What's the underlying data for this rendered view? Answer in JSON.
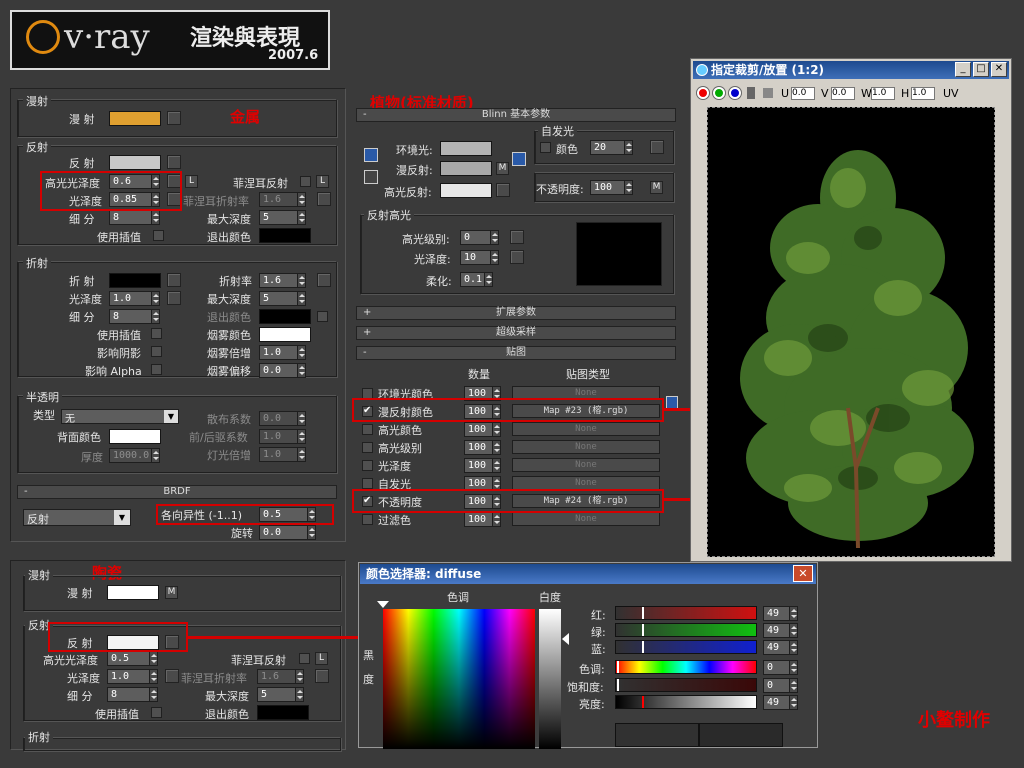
{
  "logo": {
    "brand": "v·ray",
    "title": "渲染與表現",
    "year": "2007.6"
  },
  "metal": {
    "heading": "金属",
    "diffuse_group": "漫射",
    "diffuse_label": "漫 射",
    "diffuse_color": "#e0a030",
    "reflect_group": "反射",
    "reflect_label": "反 射",
    "reflect_color": "#c8c8c8",
    "hilight_gloss_label": "高光光泽度",
    "hilight_gloss": "0.6",
    "gloss_label": "光泽度",
    "gloss": "0.85",
    "subdiv_label": "细 分",
    "subdiv": "8",
    "interp_label": "使用插值",
    "fresnel_label": "菲涅耳反射",
    "fresnel_ior_label": "菲涅耳折射率",
    "fresnel_ior": "1.6",
    "maxdepth_label": "最大深度",
    "maxdepth": "5",
    "exit_color_label": "退出颜色",
    "L": "L",
    "refract_group": "折射",
    "refract_label": "折 射",
    "ior_label": "折射率",
    "ior": "1.6",
    "r_gloss_label": "光泽度",
    "r_gloss": "1.0",
    "r_maxdepth_label": "最大深度",
    "r_maxdepth": "5",
    "r_subdiv_label": "细 分",
    "r_subdiv": "8",
    "r_exit_label": "退出颜色",
    "r_interp_label": "使用插值",
    "fog_color_label": "烟雾颜色",
    "shadow_label": "影响阴影",
    "fog_mult_label": "烟雾倍增",
    "fog_mult": "1.0",
    "alpha_label": "影响 Alpha",
    "fog_bias_label": "烟雾偏移",
    "fog_bias": "0.0",
    "trans_group": "半透明",
    "type_label": "类型",
    "type_value": "无",
    "scatter_label": "散布系数",
    "scatter": "0.0",
    "back_color_label": "背面颜色",
    "fb_label": "前/后驱系数",
    "fb": "1.0",
    "thick_label": "厚度",
    "thick": "1000.0",
    "light_mult_label": "灯光倍增",
    "light_mult": "1.0",
    "brdf_title": "BRDF",
    "brdf_type": "反射",
    "aniso_label": "各向异性 (-1..1)",
    "aniso": "0.5",
    "rotate_label": "旋转",
    "rotate": "0.0"
  },
  "blinn": {
    "heading": "植物(标准材质)",
    "rollout": "Blinn 基本参数",
    "ambient_label": "环境光:",
    "diffuse_label": "漫反射:",
    "specular_label": "高光反射:",
    "selfillum_group": "自发光",
    "color_label": "颜色",
    "selfillum": "20",
    "opacity_label": "不透明度:",
    "opacity": "100",
    "M": "M",
    "spec_group": "反射高光",
    "spec_level_label": "高光级别:",
    "spec_level": "0",
    "gloss_label": "光泽度:",
    "gloss": "10",
    "soften_label": "柔化:",
    "soften": "0.1",
    "ext_params": "扩展参数",
    "supersampling": "超级采样",
    "maps": "贴图",
    "amount_header": "数量",
    "maptype_header": "贴图类型",
    "maps_rows": [
      {
        "label": "环境光颜色",
        "amount": "100",
        "map": "None",
        "checked": false
      },
      {
        "label": "漫反射颜色",
        "amount": "100",
        "map": "Map #23 (榕.rgb)",
        "checked": true
      },
      {
        "label": "高光颜色",
        "amount": "100",
        "map": "None",
        "checked": false
      },
      {
        "label": "高光级别",
        "amount": "100",
        "map": "None",
        "checked": false
      },
      {
        "label": "光泽度",
        "amount": "100",
        "map": "None",
        "checked": false
      },
      {
        "label": "自发光",
        "amount": "100",
        "map": "None",
        "checked": false
      },
      {
        "label": "不透明度",
        "amount": "100",
        "map": "Map #24 (榕.rgb)",
        "checked": true
      },
      {
        "label": "过滤色",
        "amount": "100",
        "map": "None",
        "checked": false
      }
    ]
  },
  "crop_window": {
    "title": "指定裁剪/放置 (1:2)",
    "U": "U",
    "U_val": "0.0",
    "V": "V",
    "V_val": "0.0",
    "W": "W",
    "W_val": "1.0",
    "H": "H",
    "H_val": "1.0",
    "UV": "UV"
  },
  "ceramic": {
    "heading": "陶瓷",
    "diffuse_group": "漫射",
    "diffuse_label": "漫 射",
    "M": "M",
    "reflect_group": "反射",
    "reflect_label": "反 射",
    "hilight_gloss_label": "高光光泽度",
    "hilight_gloss": "0.5",
    "fresnel_label": "菲涅耳反射",
    "L": "L",
    "gloss_label": "光泽度",
    "gloss": "1.0",
    "fresnel_ior_label": "菲涅耳折射率",
    "fresnel_ior": "1.6",
    "subdiv_label": "细 分",
    "subdiv": "8",
    "maxdepth_label": "最大深度",
    "maxdepth": "5",
    "interp_label": "使用插值",
    "exit_label": "退出颜色",
    "refract_group": "折射"
  },
  "color_picker": {
    "title": "颜色选择器: diffuse",
    "hue_label": "色调",
    "white_label": "白度",
    "black_label": "黑",
    "degree_label": "度",
    "red_label": "红:",
    "red": "49",
    "green_label": "绿:",
    "green": "49",
    "blue_label": "蓝:",
    "blue": "49",
    "hue2_label": "色调:",
    "hue": "0",
    "sat_label": "饱和度:",
    "sat": "0",
    "val_label": "亮度:",
    "val": "49"
  },
  "credit": "小鳌制作"
}
